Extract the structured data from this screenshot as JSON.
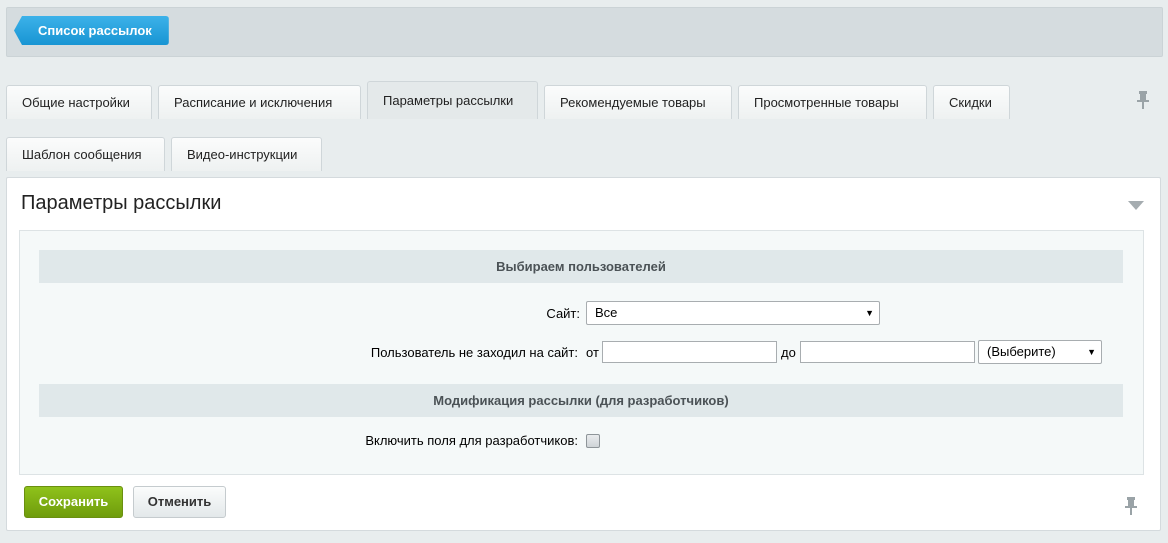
{
  "header": {
    "back_label": "Список рассылок"
  },
  "tabs_row1": [
    {
      "label": "Общие настройки"
    },
    {
      "label": "Расписание и исключения"
    },
    {
      "label": "Параметры рассылки",
      "active": true
    },
    {
      "label": "Рекомендуемые товары"
    },
    {
      "label": "Просмотренные товары"
    },
    {
      "label": "Скидки"
    }
  ],
  "tabs_row2": [
    {
      "label": "Шаблон сообщения"
    },
    {
      "label": "Видео-инструкции"
    }
  ],
  "panel": {
    "title": "Параметры рассылки",
    "section_users": "Выбираем пользователей",
    "site_label": "Сайт:",
    "site_value": "Все",
    "not_visited_label": "Пользователь не заходил на сайт:",
    "from_label": "от",
    "to_label": "до",
    "from_value": "",
    "to_value": "",
    "period_value": "(Выберите)",
    "section_dev": "Модификация рассылки (для разработчиков)",
    "dev_fields_label": "Включить поля для разработчиков:",
    "dev_fields_checked": false
  },
  "buttons": {
    "save": "Сохранить",
    "cancel": "Отменить"
  },
  "colors": {
    "accent_blue": "#1895d3",
    "save_green": "#7aab12",
    "section_bg": "#e0e8ea"
  },
  "icons": {
    "pin": "pin-icon",
    "collapse": "triangle-down-icon",
    "select_arrow": "caret-down-icon"
  }
}
